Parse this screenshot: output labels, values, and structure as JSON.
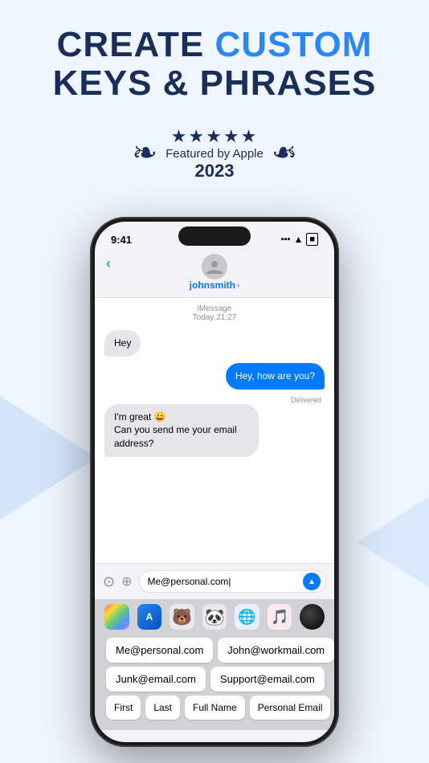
{
  "header": {
    "line1_dark": "CREATE ",
    "line1_blue": "CUSTOM",
    "line2": "KEYS & PHRASES"
  },
  "badge": {
    "stars": "★★★★★",
    "featured_text": "Featured by Apple",
    "year": "2023"
  },
  "phone": {
    "status": {
      "time": "9:41",
      "signal": "▲▲▲",
      "wifi": "wifi"
    },
    "contact": {
      "name": "johnsmith",
      "chevron": "›"
    },
    "imessage_label": "iMessage",
    "date_label": "Today 21:27",
    "messages": [
      {
        "type": "received",
        "text": "Hey"
      },
      {
        "type": "sent",
        "text": "Hey, how are you?"
      },
      {
        "type": "delivered",
        "text": "Delivered"
      },
      {
        "type": "received",
        "text": "I'm great 😀\nCan you send me your email address?"
      }
    ],
    "input_value": "Me@personal.com|",
    "chips": [
      [
        "Me@personal.com",
        "John@workmail.com"
      ],
      [
        "Junk@email.com",
        "Support@email.com"
      ],
      [
        "First",
        "Last",
        "Full Name",
        "Personal Email"
      ]
    ]
  }
}
